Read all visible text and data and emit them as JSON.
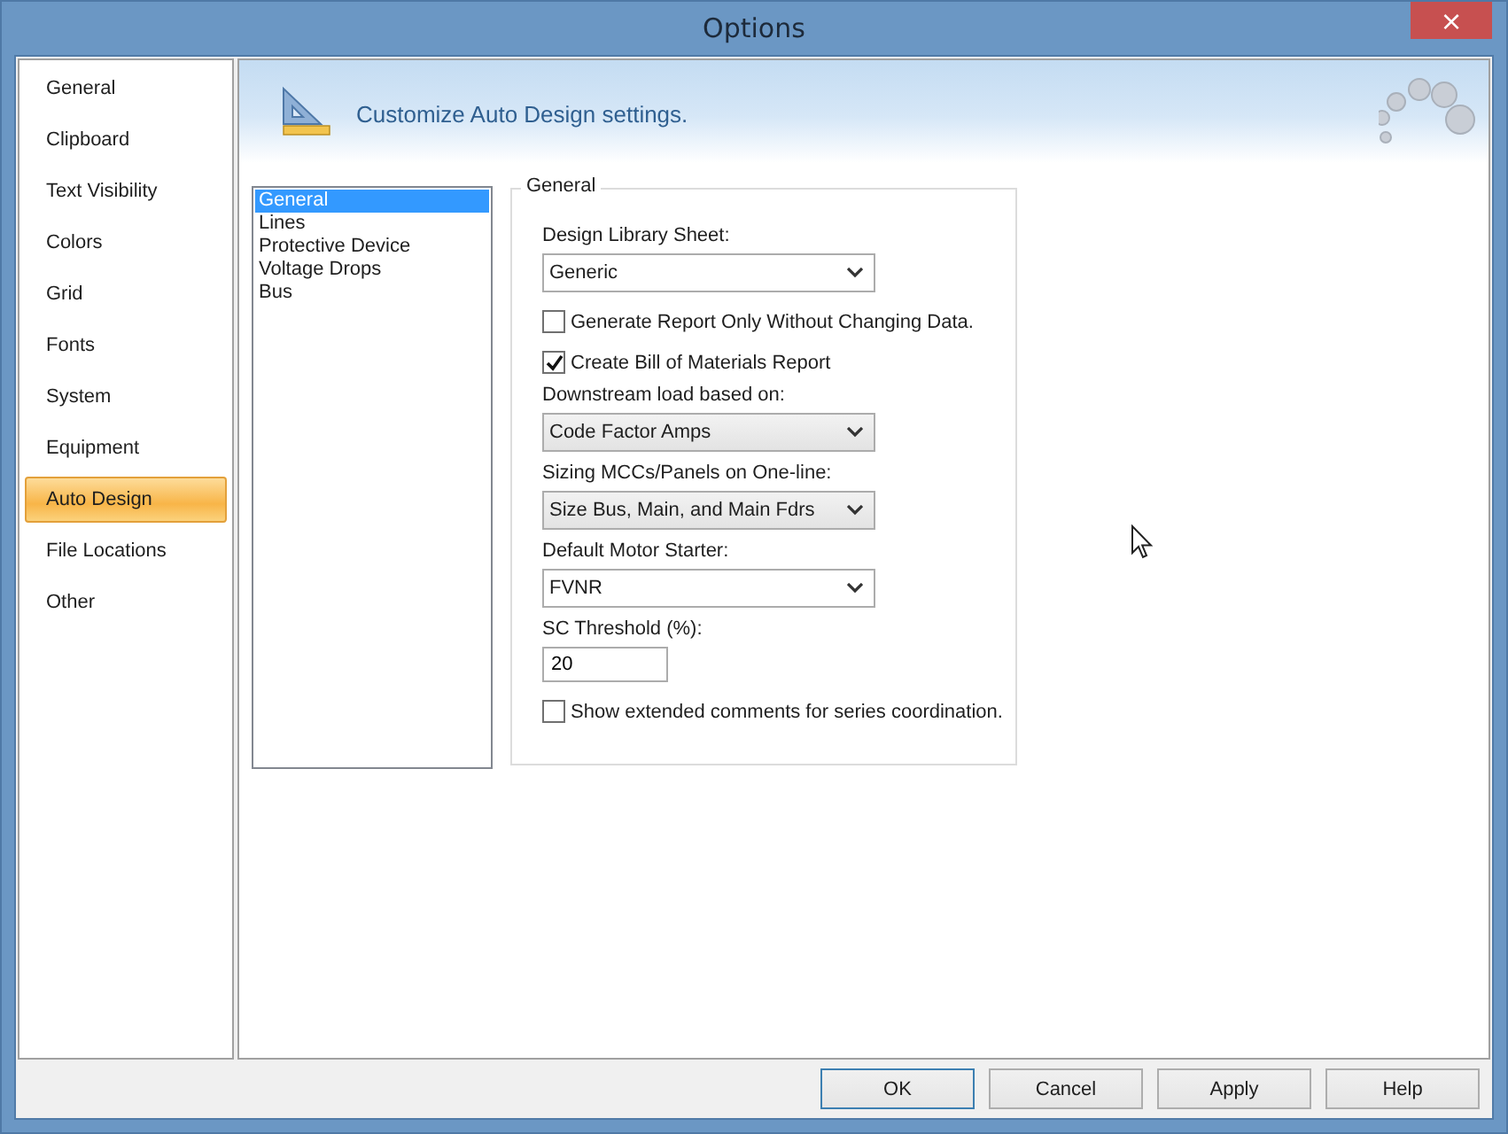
{
  "window": {
    "title": "Options",
    "close": "×"
  },
  "sidebar": {
    "items": [
      {
        "label": "General",
        "selected": false
      },
      {
        "label": "Clipboard",
        "selected": false
      },
      {
        "label": "Text Visibility",
        "selected": false
      },
      {
        "label": "Colors",
        "selected": false
      },
      {
        "label": "Grid",
        "selected": false
      },
      {
        "label": "Fonts",
        "selected": false
      },
      {
        "label": "System",
        "selected": false
      },
      {
        "label": "Equipment",
        "selected": false
      },
      {
        "label": "Auto Design",
        "selected": true
      },
      {
        "label": "File Locations",
        "selected": false
      },
      {
        "label": "Other",
        "selected": false
      }
    ]
  },
  "header": {
    "text": "Customize Auto Design settings."
  },
  "category_list": [
    {
      "label": "General",
      "selected": true
    },
    {
      "label": "Lines",
      "selected": false
    },
    {
      "label": "Protective Device",
      "selected": false
    },
    {
      "label": "Voltage Drops",
      "selected": false
    },
    {
      "label": "Bus",
      "selected": false
    }
  ],
  "group": {
    "title": "General",
    "items": [
      {
        "kind": "label",
        "text": "Design Library Sheet:"
      },
      {
        "kind": "combo",
        "value": "Generic"
      },
      {
        "kind": "checkbox",
        "text": "Generate Report Only Without Changing Data.",
        "checked": false
      },
      {
        "kind": "checkbox",
        "text": "Create Bill of Materials Report",
        "checked": true
      },
      {
        "kind": "label",
        "text": "Downstream load based on:"
      },
      {
        "kind": "dropdown",
        "value": "Code Factor Amps"
      },
      {
        "kind": "label",
        "text": "Sizing MCCs/Panels on One-line:"
      },
      {
        "kind": "dropdown",
        "value": "Size Bus, Main, and Main Fdrs"
      },
      {
        "kind": "label",
        "text": "Default Motor Starter:"
      },
      {
        "kind": "combo",
        "value": "FVNR"
      },
      {
        "kind": "label",
        "text": "SC Threshold (%):"
      },
      {
        "kind": "input",
        "value": "20"
      },
      {
        "kind": "checkbox",
        "text": "Show extended comments for series coordination.",
        "checked": false
      }
    ]
  },
  "buttons": [
    {
      "label": "OK",
      "default": true
    },
    {
      "label": "Cancel",
      "default": false
    },
    {
      "label": "Apply",
      "default": false
    },
    {
      "label": "Help",
      "default": false
    }
  ]
}
